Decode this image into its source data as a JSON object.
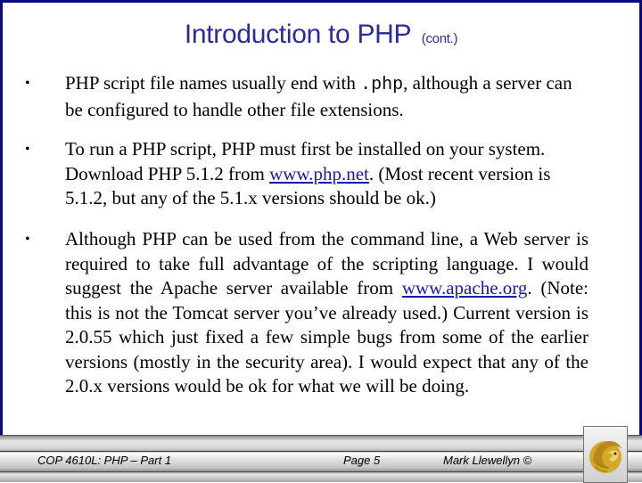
{
  "slide": {
    "title": "Introduction to PHP",
    "title_suffix": "(cont.)",
    "bullet_glyph": "•",
    "bullets": [
      {
        "pre": "PHP script file names usually end with ",
        "code": ".php",
        "post": ", although a server can be configured to handle other file extensions."
      },
      {
        "pre": "To run a PHP script, PHP must first be installed on your system. Download PHP 5.1.2 from ",
        "link": "www.php.net",
        "post": ".  (Most recent version is 5.1.2, but any of the 5.1.x versions should be ok.)"
      },
      {
        "pre": "Although PHP can be used from the command line, a Web server is required to take full advantage of the scripting language.  I would suggest the Apache server available from ",
        "link": "www.apache.org",
        "post": ".  (Note: this is not the Tomcat server you’ve already used.)  Current version is 2.0.55 which just fixed a few simple bugs from some of the earlier versions (mostly in the security area).  I would expect that any of the 2.0.x versions would be ok for what we will be doing."
      }
    ]
  },
  "footer": {
    "course": "COP 4610L:  PHP – Part 1",
    "page": "Page 5",
    "author": "Mark Llewellyn ©",
    "logo_icon": "ucf-pegasus-logo-icon"
  },
  "colors": {
    "border": "#0a0a78",
    "title": "#2b2b9a",
    "link": "#1a1aa8",
    "logo_gold": "#d4a92a"
  }
}
